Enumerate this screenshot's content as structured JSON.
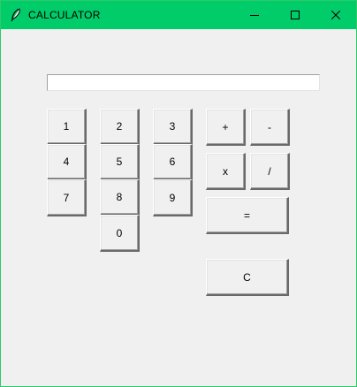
{
  "window": {
    "title": "CALCULATOR",
    "titlebar_color": "#00cc6a",
    "icons": {
      "app": "feather-icon",
      "minimize": "minimize-icon",
      "maximize": "maximize-icon",
      "close": "close-icon"
    }
  },
  "display": {
    "value": ""
  },
  "keys": {
    "k1": "1",
    "k2": "2",
    "k3": "3",
    "k4": "4",
    "k5": "5",
    "k6": "6",
    "k7": "7",
    "k8": "8",
    "k9": "9",
    "k0": "0",
    "plus": "+",
    "minus": "-",
    "multiply": "x",
    "divide": "/",
    "equals": "=",
    "clear": "C"
  }
}
